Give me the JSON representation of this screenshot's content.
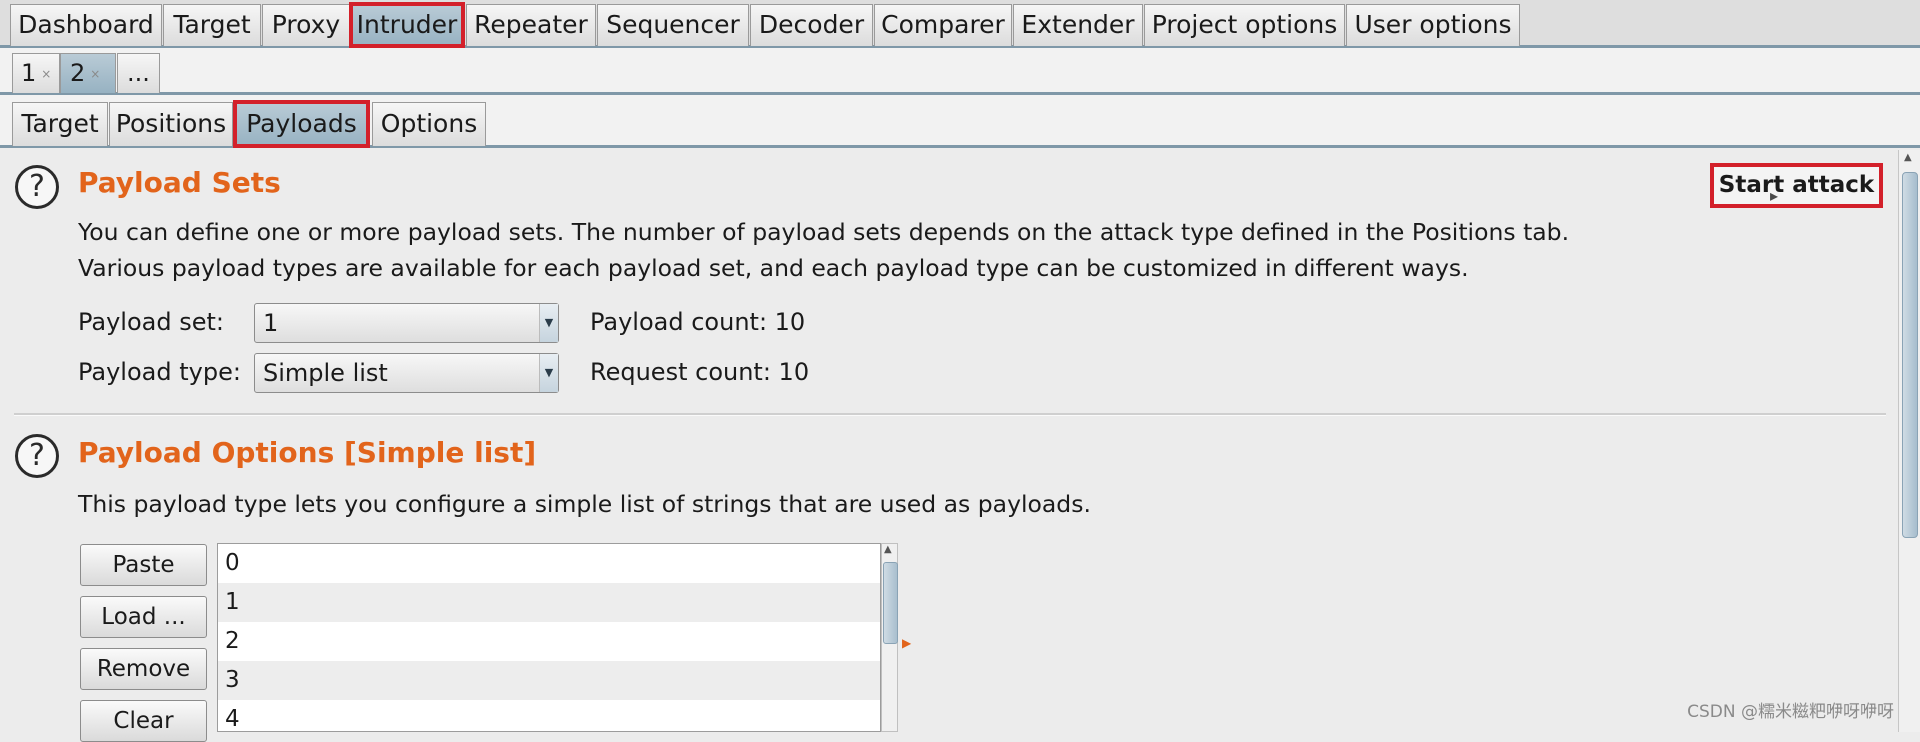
{
  "main_tabs": [
    {
      "label": "Dashboard"
    },
    {
      "label": "Target"
    },
    {
      "label": "Proxy"
    },
    {
      "label": "Intruder"
    },
    {
      "label": "Repeater"
    },
    {
      "label": "Sequencer"
    },
    {
      "label": "Decoder"
    },
    {
      "label": "Comparer"
    },
    {
      "label": "Extender"
    },
    {
      "label": "Project options"
    },
    {
      "label": "User options"
    }
  ],
  "instance_tabs": [
    {
      "label": "1",
      "close": "×"
    },
    {
      "label": "2",
      "close": "×"
    },
    {
      "label": "..."
    }
  ],
  "sub_tabs": [
    {
      "label": "Target"
    },
    {
      "label": "Positions"
    },
    {
      "label": "Payloads"
    },
    {
      "label": "Options"
    }
  ],
  "active": {
    "main_tab": "Intruder",
    "instance_tab": "2",
    "sub_tab": "Payloads"
  },
  "payload_sets": {
    "help_glyph": "?",
    "title": "Payload Sets",
    "desc_line1": "You can define one or more payload sets. The number of payload sets depends on the attack type defined in the Positions tab.",
    "desc_line2": "Various payload types are available for each payload set, and each payload type can be customized in different ways.",
    "set_label": "Payload set:",
    "set_value": "1",
    "type_label": "Payload type:",
    "type_value": "Simple list",
    "payload_count": "Payload count: 10",
    "request_count": "Request count: 10",
    "start_attack": "Start attack"
  },
  "payload_options": {
    "help_glyph": "?",
    "title": "Payload Options [Simple list]",
    "desc": "This payload type lets you configure a simple list of strings that are used as payloads.",
    "buttons": {
      "paste": "Paste",
      "load": "Load ...",
      "remove": "Remove",
      "clear": "Clear"
    },
    "items": [
      "0",
      "1",
      "2",
      "3",
      "4"
    ]
  },
  "icons": {
    "dropdown": "chevron-down-icon",
    "help": "help-circle-icon",
    "marker": "triangle-right-icon"
  },
  "colors": {
    "section_title": "#e2641b",
    "highlight": "#d3202a",
    "active_tab": "#a7bfcd"
  },
  "watermark": "CSDN @糯米糍粑咿呀咿呀"
}
